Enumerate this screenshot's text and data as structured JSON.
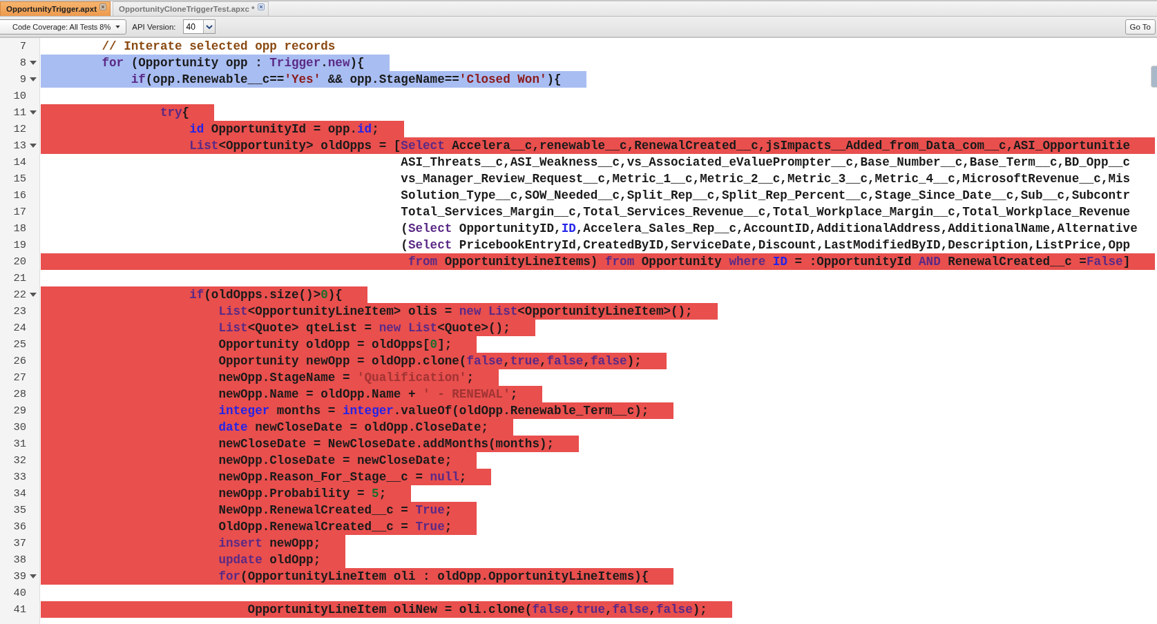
{
  "tabs": [
    {
      "label": "OpportunityTrigger.apxt",
      "selected": true
    },
    {
      "label": "OpportunityCloneTriggerTest.apxc *",
      "selected": false
    }
  ],
  "toolbar": {
    "coverage_menu": "Code Coverage: All Tests 8%",
    "api_label": "API Version:",
    "api_version": "40",
    "goto_button": "Go To"
  },
  "lines": [
    {
      "number": "7",
      "selected": false,
      "uncovered": false,
      "foldable": false,
      "tokens": [
        {
          "kind": "comment",
          "text": "        // Interate selected opp records"
        }
      ]
    },
    {
      "number": "8",
      "selected": true,
      "uncovered": false,
      "foldable": true,
      "tokens": [
        {
          "kind": "keyword",
          "text": "        for"
        },
        {
          "kind": "plain",
          "text": " (Opportunity opp : "
        },
        {
          "kind": "keyword",
          "text": "Trigger"
        },
        {
          "kind": "plain",
          "text": "."
        },
        {
          "kind": "keyword",
          "text": "new"
        },
        {
          "kind": "plain",
          "text": "){"
        }
      ]
    },
    {
      "number": "9",
      "selected": true,
      "uncovered": false,
      "foldable": true,
      "tokens": [
        {
          "kind": "keyword",
          "text": "            if"
        },
        {
          "kind": "plain",
          "text": "(opp.Renewable__c=="
        },
        {
          "kind": "string",
          "text": "'Yes'"
        },
        {
          "kind": "plain",
          "text": " && opp.StageName=="
        },
        {
          "kind": "string",
          "text": "'Closed Won'"
        },
        {
          "kind": "plain",
          "text": "){"
        }
      ]
    },
    {
      "number": "10",
      "selected": false,
      "uncovered": false,
      "foldable": false
    },
    {
      "number": "11",
      "selected": false,
      "uncovered": true,
      "foldable": true,
      "tokens": [
        {
          "kind": "keyword",
          "text": "                try"
        },
        {
          "kind": "plain",
          "text": "{"
        }
      ]
    },
    {
      "number": "12",
      "selected": false,
      "uncovered": true,
      "foldable": false,
      "tokens": [
        {
          "kind": "type",
          "text": "                    id"
        },
        {
          "kind": "plain",
          "text": " OpportunityId = opp."
        },
        {
          "kind": "type",
          "text": "id"
        },
        {
          "kind": "plain",
          "text": ";"
        }
      ]
    },
    {
      "number": "13",
      "selected": false,
      "uncovered": true,
      "foldable": true,
      "tokens": [
        {
          "kind": "keyword",
          "text": "                    List"
        },
        {
          "kind": "plain",
          "text": "<Opportunity> oldOpps = ["
        },
        {
          "kind": "keyword",
          "text": "Select"
        },
        {
          "kind": "plain",
          "text": " Accelera__c,renewable__c,RenewalCreated__c,jsImpacts__Added_from_Data_com__c,ASI_Opportunitie"
        }
      ]
    },
    {
      "number": "14",
      "selected": false,
      "uncovered": false,
      "foldable": false,
      "tokens": [
        {
          "kind": "plain",
          "text": "                                                 ASI_Threats__c,ASI_Weakness__c,vs_Associated_eValuePrompter__c,Base_Number__c,Base_Term__c,BD_Opp__c"
        }
      ]
    },
    {
      "number": "15",
      "selected": false,
      "uncovered": false,
      "foldable": false,
      "tokens": [
        {
          "kind": "plain",
          "text": "                                                 vs_Manager_Review_Request__c,Metric_1__c,Metric_2__c,Metric_3__c,Metric_4__c,MicrosoftRevenue__c,Mis"
        }
      ]
    },
    {
      "number": "16",
      "selected": false,
      "uncovered": false,
      "foldable": false,
      "tokens": [
        {
          "kind": "plain",
          "text": "                                                 Solution_Type__c,SOW_Needed__c,Split_Rep__c,Split_Rep_Percent__c,Stage_Since_Date__c,Sub__c,Subcontr"
        }
      ]
    },
    {
      "number": "17",
      "selected": false,
      "uncovered": false,
      "foldable": false,
      "tokens": [
        {
          "kind": "plain",
          "text": "                                                 Total_Services_Margin__c,Total_Services_Revenue__c,Total_Workplace_Margin__c,Total_Workplace_Revenue"
        }
      ]
    },
    {
      "number": "18",
      "selected": false,
      "uncovered": false,
      "foldable": false,
      "tokens": [
        {
          "kind": "plain",
          "text": "                                                 ("
        },
        {
          "kind": "keyword",
          "text": "Select"
        },
        {
          "kind": "plain",
          "text": " OpportunityID,"
        },
        {
          "kind": "type",
          "text": "ID"
        },
        {
          "kind": "plain",
          "text": ",Accelera_Sales_Rep__c,AccountID,AdditionalAddress,AdditionalName,Alternative"
        }
      ]
    },
    {
      "number": "19",
      "selected": false,
      "uncovered": false,
      "foldable": false,
      "tokens": [
        {
          "kind": "plain",
          "text": "                                                 ("
        },
        {
          "kind": "keyword",
          "text": "Select"
        },
        {
          "kind": "plain",
          "text": " PricebookEntryId,CreatedByID,ServiceDate,Discount,LastModifiedByID,Description,ListPrice,Opp"
        }
      ]
    },
    {
      "number": "20",
      "selected": false,
      "uncovered": true,
      "foldable": false,
      "tokens": [
        {
          "kind": "keyword",
          "text": "                                                  from"
        },
        {
          "kind": "plain",
          "text": " OpportunityLineItems) "
        },
        {
          "kind": "keyword",
          "text": "from"
        },
        {
          "kind": "plain",
          "text": " Opportunity "
        },
        {
          "kind": "keyword",
          "text": "where "
        },
        {
          "kind": "type",
          "text": "ID"
        },
        {
          "kind": "plain",
          "text": " = :OpportunityId "
        },
        {
          "kind": "keyword",
          "text": "AND"
        },
        {
          "kind": "plain",
          "text": " RenewalCreated__c ="
        },
        {
          "kind": "keyword",
          "text": "False"
        },
        {
          "kind": "plain",
          "text": "]"
        }
      ]
    },
    {
      "number": "21",
      "selected": false,
      "uncovered": false,
      "foldable": false
    },
    {
      "number": "22",
      "selected": false,
      "uncovered": true,
      "foldable": true,
      "tokens": [
        {
          "kind": "keyword",
          "text": "                    if"
        },
        {
          "kind": "plain",
          "text": "(oldOpps.size()>"
        },
        {
          "kind": "number",
          "text": "0"
        },
        {
          "kind": "plain",
          "text": "){"
        }
      ]
    },
    {
      "number": "23",
      "selected": false,
      "uncovered": true,
      "foldable": false,
      "tokens": [
        {
          "kind": "keyword",
          "text": "                        List"
        },
        {
          "kind": "plain",
          "text": "<OpportunityLineItem> olis = "
        },
        {
          "kind": "keyword",
          "text": "new List"
        },
        {
          "kind": "plain",
          "text": "<OpportunityLineItem>();"
        }
      ]
    },
    {
      "number": "24",
      "selected": false,
      "uncovered": true,
      "foldable": false,
      "tokens": [
        {
          "kind": "keyword",
          "text": "                        List"
        },
        {
          "kind": "plain",
          "text": "<Quote> qteList = "
        },
        {
          "kind": "keyword",
          "text": "new List"
        },
        {
          "kind": "plain",
          "text": "<Quote>();"
        }
      ]
    },
    {
      "number": "25",
      "selected": false,
      "uncovered": true,
      "foldable": false,
      "tokens": [
        {
          "kind": "plain",
          "text": "                        Opportunity oldOpp = oldOpps["
        },
        {
          "kind": "number",
          "text": "0"
        },
        {
          "kind": "plain",
          "text": "];"
        }
      ]
    },
    {
      "number": "26",
      "selected": false,
      "uncovered": true,
      "foldable": false,
      "tokens": [
        {
          "kind": "plain",
          "text": "                        Opportunity newOpp = oldOpp.clone("
        },
        {
          "kind": "keyword",
          "text": "false"
        },
        {
          "kind": "plain",
          "text": ","
        },
        {
          "kind": "keyword",
          "text": "true"
        },
        {
          "kind": "plain",
          "text": ","
        },
        {
          "kind": "keyword",
          "text": "false"
        },
        {
          "kind": "plain",
          "text": ","
        },
        {
          "kind": "keyword",
          "text": "false"
        },
        {
          "kind": "plain",
          "text": ");"
        }
      ]
    },
    {
      "number": "27",
      "selected": false,
      "uncovered": true,
      "foldable": false,
      "tokens": [
        {
          "kind": "plain",
          "text": "                        newOpp.StageName = "
        },
        {
          "kind": "string",
          "text": "'Qualification'"
        },
        {
          "kind": "plain",
          "text": ";"
        }
      ]
    },
    {
      "number": "28",
      "selected": false,
      "uncovered": true,
      "foldable": false,
      "tokens": [
        {
          "kind": "plain",
          "text": "                        newOpp.Name = oldOpp.Name + "
        },
        {
          "kind": "string",
          "text": "' - RENEWAL'"
        },
        {
          "kind": "plain",
          "text": ";"
        }
      ]
    },
    {
      "number": "29",
      "selected": false,
      "uncovered": true,
      "foldable": false,
      "tokens": [
        {
          "kind": "type",
          "text": "                        integer"
        },
        {
          "kind": "plain",
          "text": " months = "
        },
        {
          "kind": "type",
          "text": "integer"
        },
        {
          "kind": "plain",
          "text": ".valueOf(oldOpp.Renewable_Term__c);"
        }
      ]
    },
    {
      "number": "30",
      "selected": false,
      "uncovered": true,
      "foldable": false,
      "tokens": [
        {
          "kind": "type",
          "text": "                        date"
        },
        {
          "kind": "plain",
          "text": " newCloseDate = oldOpp.CloseDate;"
        }
      ]
    },
    {
      "number": "31",
      "selected": false,
      "uncovered": true,
      "foldable": false,
      "tokens": [
        {
          "kind": "plain",
          "text": "                        newCloseDate = NewCloseDate.addMonths(months);"
        }
      ]
    },
    {
      "number": "32",
      "selected": false,
      "uncovered": true,
      "foldable": false,
      "tokens": [
        {
          "kind": "plain",
          "text": "                        newOpp.CloseDate = newCloseDate;"
        }
      ]
    },
    {
      "number": "33",
      "selected": false,
      "uncovered": true,
      "foldable": false,
      "tokens": [
        {
          "kind": "plain",
          "text": "                        newOpp.Reason_For_Stage__c = "
        },
        {
          "kind": "keyword",
          "text": "null"
        },
        {
          "kind": "plain",
          "text": ";"
        }
      ]
    },
    {
      "number": "34",
      "selected": false,
      "uncovered": true,
      "foldable": false,
      "tokens": [
        {
          "kind": "plain",
          "text": "                        newOpp.Probability = "
        },
        {
          "kind": "number",
          "text": "5"
        },
        {
          "kind": "plain",
          "text": ";"
        }
      ]
    },
    {
      "number": "35",
      "selected": false,
      "uncovered": true,
      "foldable": false,
      "tokens": [
        {
          "kind": "plain",
          "text": "                        NewOpp.RenewalCreated__c = "
        },
        {
          "kind": "keyword",
          "text": "True"
        },
        {
          "kind": "plain",
          "text": ";"
        }
      ]
    },
    {
      "number": "36",
      "selected": false,
      "uncovered": true,
      "foldable": false,
      "tokens": [
        {
          "kind": "plain",
          "text": "                        OldOpp.RenewalCreated__c = "
        },
        {
          "kind": "keyword",
          "text": "True"
        },
        {
          "kind": "plain",
          "text": ";"
        }
      ]
    },
    {
      "number": "37",
      "selected": false,
      "uncovered": true,
      "foldable": false,
      "tokens": [
        {
          "kind": "keyword",
          "text": "                        insert"
        },
        {
          "kind": "plain",
          "text": " newOpp;"
        }
      ]
    },
    {
      "number": "38",
      "selected": false,
      "uncovered": true,
      "foldable": false,
      "tokens": [
        {
          "kind": "keyword",
          "text": "                        update"
        },
        {
          "kind": "plain",
          "text": " oldOpp;"
        }
      ]
    },
    {
      "number": "39",
      "selected": false,
      "uncovered": true,
      "foldable": true,
      "tokens": [
        {
          "kind": "keyword",
          "text": "                        for"
        },
        {
          "kind": "plain",
          "text": "(OpportunityLineItem oli : oldOpp.OpportunityLineItems){"
        }
      ]
    },
    {
      "number": "40",
      "selected": false,
      "uncovered": false,
      "foldable": false
    },
    {
      "number": "41",
      "selected": false,
      "uncovered": true,
      "foldable": false,
      "tokens": [
        {
          "kind": "plain",
          "text": "                            OpportunityLineItem oliNew = oli.clone("
        },
        {
          "kind": "keyword",
          "text": "false"
        },
        {
          "kind": "plain",
          "text": ","
        },
        {
          "kind": "keyword",
          "text": "true"
        },
        {
          "kind": "plain",
          "text": ","
        },
        {
          "kind": "keyword",
          "text": "false"
        },
        {
          "kind": "plain",
          "text": ","
        },
        {
          "kind": "keyword",
          "text": "false"
        },
        {
          "kind": "plain",
          "text": ");"
        }
      ]
    }
  ]
}
